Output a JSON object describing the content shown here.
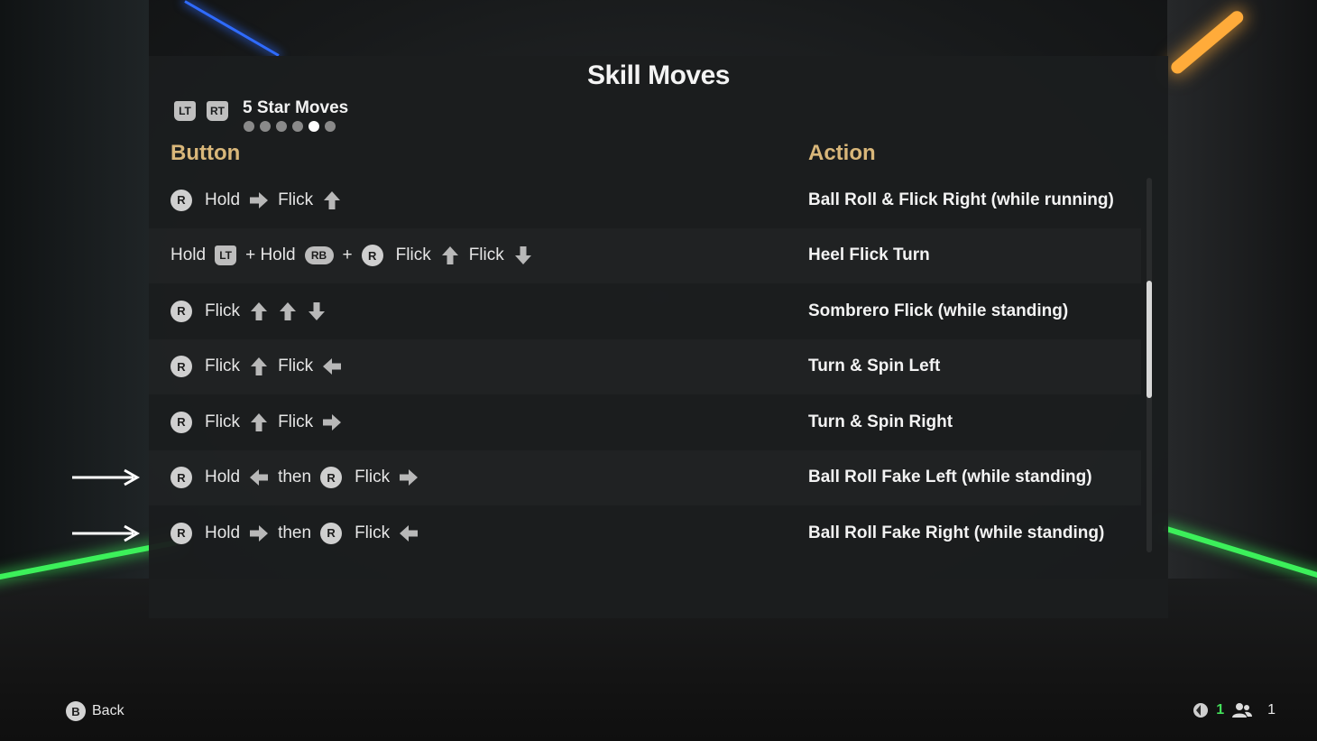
{
  "title": "Skill Moves",
  "page_nav": {
    "prev_trigger": "LT",
    "next_trigger": "RT",
    "page_label": "5 Star Moves",
    "page_count": 6,
    "active_page_index": 4
  },
  "headers": {
    "button": "Button",
    "action": "Action"
  },
  "rows": [
    {
      "action": "Ball Roll & Flick Right (while running)",
      "seq": [
        {
          "t": "r",
          "v": "R"
        },
        {
          "t": "w",
          "v": "Hold"
        },
        {
          "t": "a",
          "v": "right"
        },
        {
          "t": "w",
          "v": "Flick"
        },
        {
          "t": "a",
          "v": "up"
        }
      ]
    },
    {
      "action": "Heel Flick Turn",
      "seq": [
        {
          "t": "w",
          "v": "Hold"
        },
        {
          "t": "lt",
          "v": "LT"
        },
        {
          "t": "w",
          "v": "+ Hold"
        },
        {
          "t": "rb",
          "v": "RB"
        },
        {
          "t": "w",
          "v": "+"
        },
        {
          "t": "r",
          "v": "R"
        },
        {
          "t": "w",
          "v": "Flick"
        },
        {
          "t": "a",
          "v": "up"
        },
        {
          "t": "w",
          "v": "Flick"
        },
        {
          "t": "a",
          "v": "down"
        }
      ]
    },
    {
      "action": "Sombrero Flick (while standing)",
      "seq": [
        {
          "t": "r",
          "v": "R"
        },
        {
          "t": "w",
          "v": "Flick"
        },
        {
          "t": "a",
          "v": "up"
        },
        {
          "t": "a",
          "v": "up"
        },
        {
          "t": "a",
          "v": "down"
        }
      ]
    },
    {
      "action": "Turn & Spin Left",
      "seq": [
        {
          "t": "r",
          "v": "R"
        },
        {
          "t": "w",
          "v": "Flick"
        },
        {
          "t": "a",
          "v": "up"
        },
        {
          "t": "w",
          "v": "Flick"
        },
        {
          "t": "a",
          "v": "left"
        }
      ]
    },
    {
      "action": "Turn & Spin Right",
      "seq": [
        {
          "t": "r",
          "v": "R"
        },
        {
          "t": "w",
          "v": "Flick"
        },
        {
          "t": "a",
          "v": "up"
        },
        {
          "t": "w",
          "v": "Flick"
        },
        {
          "t": "a",
          "v": "right"
        }
      ]
    },
    {
      "action": "Ball Roll Fake Left (while standing)",
      "seq": [
        {
          "t": "r",
          "v": "R"
        },
        {
          "t": "w",
          "v": "Hold"
        },
        {
          "t": "a",
          "v": "left"
        },
        {
          "t": "w",
          "v": "then"
        },
        {
          "t": "r",
          "v": "R"
        },
        {
          "t": "w",
          "v": "Flick"
        },
        {
          "t": "a",
          "v": "right"
        }
      ]
    },
    {
      "action": "Ball Roll Fake Right (while standing)",
      "seq": [
        {
          "t": "r",
          "v": "R"
        },
        {
          "t": "w",
          "v": "Hold"
        },
        {
          "t": "a",
          "v": "right"
        },
        {
          "t": "w",
          "v": "then"
        },
        {
          "t": "r",
          "v": "R"
        },
        {
          "t": "w",
          "v": "Flick"
        },
        {
          "t": "a",
          "v": "left"
        }
      ]
    }
  ],
  "footer": {
    "back_button": "B",
    "back_label": "Back",
    "players_in_left": "1",
    "players_total": "1"
  },
  "colors": {
    "header_gold": "#d9b77a",
    "neon_green": "#3cf05a",
    "status_green": "#43e05a"
  }
}
